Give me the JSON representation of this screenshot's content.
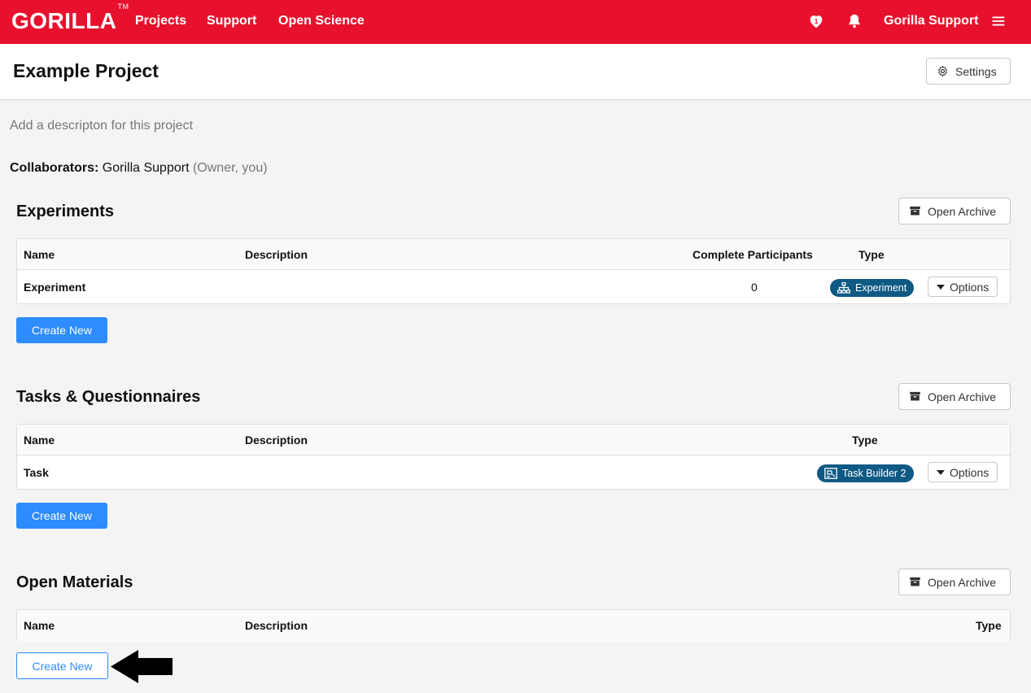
{
  "topbar": {
    "logo": "GORILLA",
    "logo_tm": "TM",
    "nav": [
      "Projects",
      "Support",
      "Open Science"
    ],
    "user": "Gorilla Support",
    "icons": [
      "heart-notification-icon",
      "bell-icon",
      "hamburger-menu-icon"
    ],
    "heart_count": "1",
    "color": "#e8112d"
  },
  "header": {
    "title": "Example Project",
    "settings_label": "Settings"
  },
  "project": {
    "description_placeholder": "Add a descripton for this project",
    "collaborators_label": "Collaborators:",
    "collaborator_name": "Gorilla Support",
    "collaborator_role": "(Owner, you)"
  },
  "experiments": {
    "title": "Experiments",
    "archive_label": "Open Archive",
    "columns": [
      "Name",
      "Description",
      "Complete Participants",
      "Type"
    ],
    "rows": [
      {
        "name": "Experiment",
        "description": "",
        "participants": "0",
        "type": "Experiment",
        "options": "Options"
      }
    ],
    "create_label": "Create New"
  },
  "tasks": {
    "title": "Tasks & Questionnaires",
    "archive_label": "Open Archive",
    "columns": [
      "Name",
      "Description",
      "Type"
    ],
    "rows": [
      {
        "name": "Task",
        "description": "",
        "type": "Task Builder 2",
        "options": "Options"
      }
    ],
    "create_label": "Create New"
  },
  "materials": {
    "title": "Open Materials",
    "archive_label": "Open Archive",
    "columns": [
      "Name",
      "Description",
      "Type"
    ],
    "create_label": "Create New"
  },
  "colors": {
    "brand": "#e8112d",
    "primary": "#2d8cff",
    "badge": "#0f5a85"
  }
}
